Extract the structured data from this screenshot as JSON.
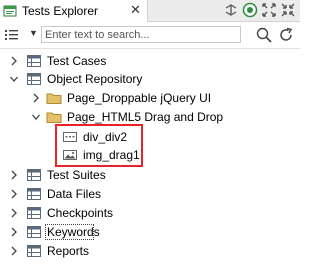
{
  "panel": {
    "title": "Tests Explorer",
    "close_glyph": "✕"
  },
  "toolbar": {
    "icons": [
      "link-icon",
      "repository-icon",
      "expand-all-icon",
      "collapse-all-icon"
    ]
  },
  "search": {
    "placeholder": "Enter text to search...",
    "value": ""
  },
  "tree": {
    "items": [
      {
        "label": "Test Cases",
        "icon": "table-icon",
        "expanded": false
      },
      {
        "label": "Object Repository",
        "icon": "table-icon",
        "expanded": true
      },
      {
        "label": "Page_Droppable  jQuery UI",
        "icon": "folder-icon",
        "expanded": false
      },
      {
        "label": "Page_HTML5 Drag and Drop",
        "icon": "folder-icon",
        "expanded": true
      },
      {
        "label": "div_div2",
        "icon": "web-element-icon"
      },
      {
        "label": "img_drag1",
        "icon": "image-element-icon"
      },
      {
        "label": "Test Suites",
        "icon": "table-icon",
        "expanded": false
      },
      {
        "label": "Data Files",
        "icon": "table-icon",
        "expanded": false
      },
      {
        "label": "Checkpoints",
        "icon": "table-icon",
        "expanded": false
      },
      {
        "label": "Keywords",
        "icon": "table-icon",
        "expanded": false
      },
      {
        "label": "Reports",
        "icon": "table-icon",
        "expanded": false
      }
    ]
  },
  "colors": {
    "highlight_border": "#e8232a",
    "folder": "#e3c069",
    "table_icon": "#5a6a7a"
  }
}
